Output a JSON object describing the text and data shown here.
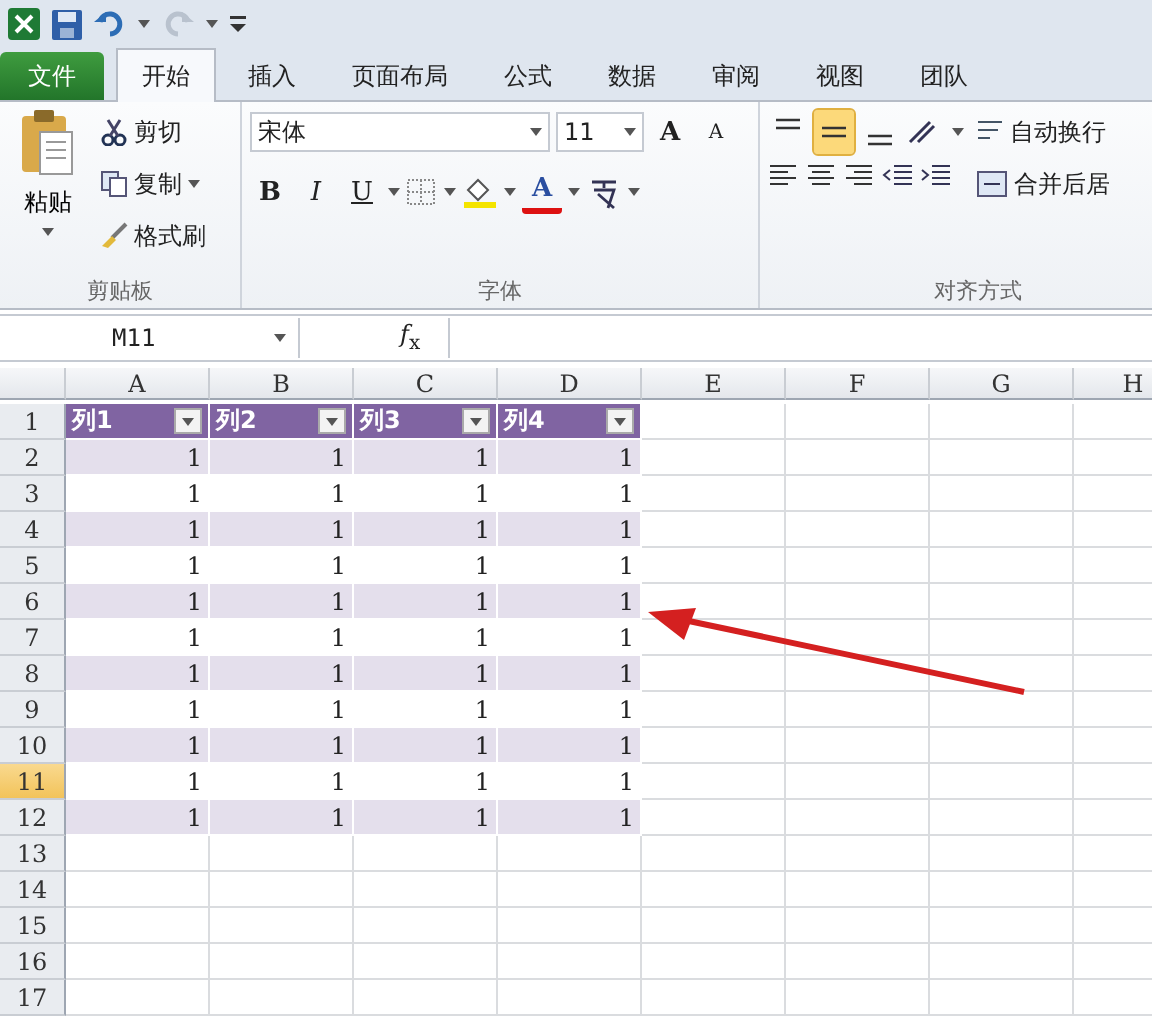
{
  "tabs": [
    {
      "label": "文件",
      "kind": "file",
      "selected": false
    },
    {
      "label": "开始",
      "kind": "tab",
      "selected": true
    },
    {
      "label": "插入",
      "kind": "tab",
      "selected": false
    },
    {
      "label": "页面布局",
      "kind": "tab",
      "selected": false
    },
    {
      "label": "公式",
      "kind": "tab",
      "selected": false
    },
    {
      "label": "数据",
      "kind": "tab",
      "selected": false
    },
    {
      "label": "审阅",
      "kind": "tab",
      "selected": false
    },
    {
      "label": "视图",
      "kind": "tab",
      "selected": false
    },
    {
      "label": "团队",
      "kind": "tab",
      "selected": false
    }
  ],
  "clipboard": {
    "paste": "粘贴",
    "cut": "剪切",
    "copy": "复制",
    "painter": "格式刷",
    "label": "剪贴板"
  },
  "font": {
    "name": "宋体",
    "size": "11",
    "grow": "A",
    "shrink": "A",
    "bold": "B",
    "italic": "I",
    "underline": "U",
    "color_letter": "A",
    "label": "字体"
  },
  "alignment": {
    "vertical": [
      {
        "selected": false
      },
      {
        "selected": true
      },
      {
        "selected": false
      }
    ],
    "wrap": "自动换行",
    "merge": "合并后居",
    "label": "对齐方式"
  },
  "name_box": "M11",
  "fx": "*f*$_{x}$",
  "columns": [
    "A",
    "B",
    "C",
    "D",
    "E",
    "F",
    "G",
    "H"
  ],
  "rows": [
    {
      "label": "1",
      "selected": false,
      "cells": [
        "列1",
        "列2",
        "列3",
        "列4"
      ]
    },
    {
      "label": "2",
      "selected": false,
      "cells": [
        "1",
        "1",
        "1",
        "1"
      ]
    },
    {
      "label": "3",
      "selected": false,
      "cells": [
        "1",
        "1",
        "1",
        "1"
      ]
    },
    {
      "label": "4",
      "selected": false,
      "cells": [
        "1",
        "1",
        "1",
        "1"
      ]
    },
    {
      "label": "5",
      "selected": false,
      "cells": [
        "1",
        "1",
        "1",
        "1"
      ]
    },
    {
      "label": "6",
      "selected": false,
      "cells": [
        "1",
        "1",
        "1",
        "1"
      ]
    },
    {
      "label": "7",
      "selected": false,
      "cells": [
        "1",
        "1",
        "1",
        "1"
      ]
    },
    {
      "label": "8",
      "selected": false,
      "cells": [
        "1",
        "1",
        "1",
        "1"
      ]
    },
    {
      "label": "9",
      "selected": false,
      "cells": [
        "1",
        "1",
        "1",
        "1"
      ]
    },
    {
      "label": "10",
      "selected": false,
      "cells": [
        "1",
        "1",
        "1",
        "1"
      ]
    },
    {
      "label": "11",
      "selected": true,
      "cells": [
        "1",
        "1",
        "1",
        "1"
      ]
    },
    {
      "label": "12",
      "selected": false,
      "cells": [
        "1",
        "1",
        "1",
        "1"
      ]
    },
    {
      "label": "13",
      "selected": false,
      "cells": []
    },
    {
      "label": "14",
      "selected": false,
      "cells": []
    },
    {
      "label": "15",
      "selected": false,
      "cells": []
    },
    {
      "label": "16",
      "selected": false,
      "cells": []
    },
    {
      "label": "17",
      "selected": false,
      "cells": []
    }
  ]
}
